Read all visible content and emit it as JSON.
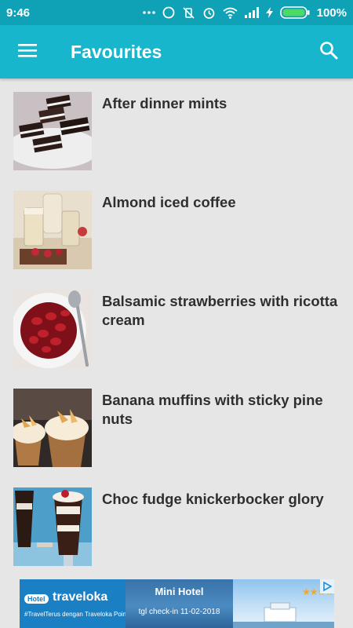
{
  "status_bar": {
    "time": "9:46",
    "battery_text": "100%",
    "icons": [
      "more-dots-icon",
      "sync-circle-icon",
      "vibrate-off-icon",
      "alarm-icon",
      "wifi-icon",
      "signal-icon",
      "charging-icon",
      "battery-icon"
    ]
  },
  "app_bar": {
    "title": "Favourites",
    "menu_icon": "hamburger-menu-icon",
    "search_icon": "search-icon",
    "color": "#17b6cc"
  },
  "recipes": [
    {
      "title": "After dinner mints"
    },
    {
      "title": "Almond iced coffee"
    },
    {
      "title": "Balsamic strawberries with ricotta cream"
    },
    {
      "title": "Banana muffins with sticky pine nuts"
    },
    {
      "title": "Choc fudge knickerbocker glory"
    }
  ],
  "ad": {
    "hotel_pill": "Hotel",
    "brand": "traveloka",
    "tagline": "#TravelTerus dengan Traveloka Poin",
    "headline": "Mini Hotel",
    "checkin": "tgl check-in 11-02-2018",
    "rating_stars": 4,
    "stars": "★★★★"
  }
}
